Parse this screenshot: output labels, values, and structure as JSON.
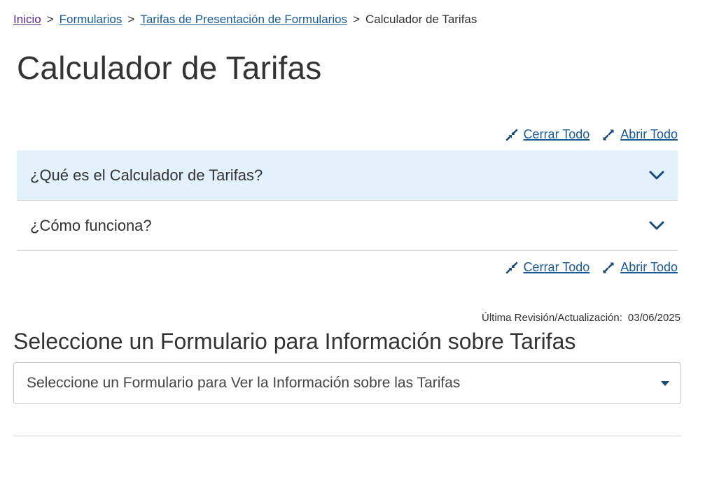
{
  "breadcrumb": {
    "items": [
      {
        "label": "Inicio"
      },
      {
        "label": "Formularios"
      },
      {
        "label": "Tarifas de Presentación de Formularios"
      }
    ],
    "separator": ">",
    "current": "Calculador de Tarifas"
  },
  "page": {
    "title": "Calculador de Tarifas"
  },
  "accordion_controls": {
    "collapse_all": "Cerrar Todo",
    "expand_all": "Abrir Todo"
  },
  "accordion": {
    "items": [
      {
        "question": "¿Qué es el Calculador de Tarifas?",
        "icon": "chevron-down-icon"
      },
      {
        "question": "¿Cómo funciona?",
        "icon": "chevron-down-icon"
      }
    ]
  },
  "last_updated": {
    "label": "Última Revisión/Actualización:",
    "date": "03/06/2025"
  },
  "form_select": {
    "heading": "Seleccione un Formulario para Información sobre Tarifas",
    "selected": "Seleccione un Formulario para Ver la Información sobre las Tarifas"
  },
  "colors": {
    "link": "#1a5a96",
    "visited_link": "#5b2a86",
    "active_row_bg": "#e3f1fc",
    "chevron": "#1a4b7a"
  }
}
